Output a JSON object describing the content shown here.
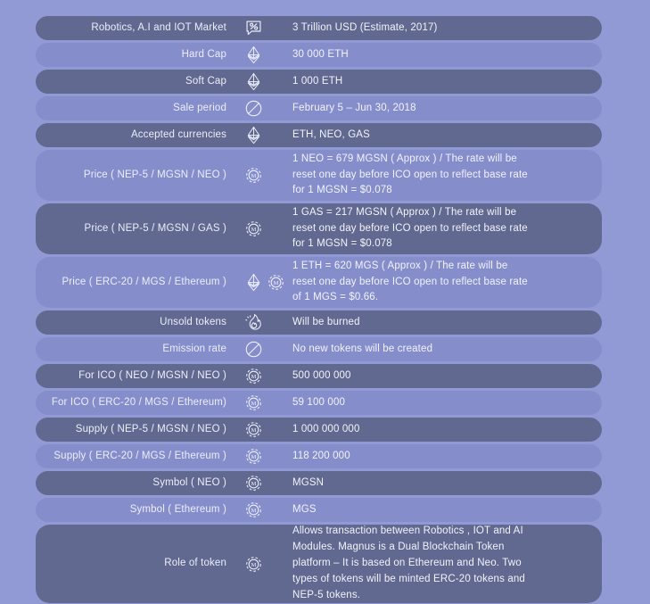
{
  "theme": {
    "background": "#919ad4",
    "row_dark": "#616990",
    "row_light": "#858ecb",
    "text": "#eceefb"
  },
  "table": {
    "name": "token-sale-details",
    "rows": [
      {
        "label": "Robotics, A.I and IOT Market",
        "icons": [
          "percent-bubble-icon"
        ],
        "value_lines": [
          "3 Trillion USD (Estimate, 2017)"
        ],
        "shade": "dark"
      },
      {
        "label": "Hard Cap",
        "icons": [
          "ethereum-icon"
        ],
        "value_lines": [
          "30 000 ETH"
        ],
        "shade": "light"
      },
      {
        "label": "Soft Cap",
        "icons": [
          "ethereum-icon"
        ],
        "value_lines": [
          "1 000 ETH"
        ],
        "shade": "dark"
      },
      {
        "label": "Sale period",
        "icons": [
          "circle-slash-icon"
        ],
        "value_lines": [
          "February 5 – Jun 30, 2018"
        ],
        "shade": "light"
      },
      {
        "label": "Accepted currencies",
        "icons": [
          "ethereum-icon"
        ],
        "value_lines": [
          "ETH, NEO, GAS"
        ],
        "shade": "dark"
      },
      {
        "label": "Price ( NEP-5 / MGSN / NEO )",
        "icons": [
          "magnus-token-icon"
        ],
        "value_lines": [
          "1 NEO = 679 MGSN ( Approx ) / The rate will be",
          "reset one day before ICO open to reflect base rate",
          "for 1 MGSN = $0.078"
        ],
        "shade": "light"
      },
      {
        "label": "Price ( NEP-5 / MGSN / GAS )",
        "icons": [
          "magnus-token-icon"
        ],
        "value_lines": [
          "1 GAS = 217 MGSN ( Approx ) / The rate will be",
          "reset one day before ICO open to reflect base rate",
          "for 1 MGSN = $0.078"
        ],
        "shade": "dark"
      },
      {
        "label": "Price ( ERC-20 / MGS / Ethereum )",
        "icons": [
          "ethereum-icon",
          "magnus-token-icon"
        ],
        "value_lines": [
          "1 ETH = 620 MGS ( Approx ) / The rate will be",
          "reset one day before ICO open to reflect base rate",
          "of 1 MGS = $0.66."
        ],
        "shade": "light"
      },
      {
        "label": "Unsold tokens",
        "icons": [
          "flame-icon"
        ],
        "value_lines": [
          "Will be burned"
        ],
        "shade": "dark"
      },
      {
        "label": "Emission rate",
        "icons": [
          "circle-slash-icon"
        ],
        "value_lines": [
          "No new tokens will be created"
        ],
        "shade": "light"
      },
      {
        "label": "For ICO ( NEO / MGSN / NEO )",
        "icons": [
          "magnus-token-icon"
        ],
        "value_lines": [
          "500 000 000"
        ],
        "shade": "dark"
      },
      {
        "label": "For ICO ( ERC-20 / MGS / Ethereum)",
        "icons": [
          "magnus-token-icon"
        ],
        "value_lines": [
          "59 100 000"
        ],
        "shade": "light"
      },
      {
        "label": "Supply ( NEP-5 / MGSN / NEO )",
        "icons": [
          "magnus-token-icon"
        ],
        "value_lines": [
          "1 000 000 000"
        ],
        "shade": "dark"
      },
      {
        "label": "Supply ( ERC-20 / MGS / Ethereum )",
        "icons": [
          "magnus-token-icon"
        ],
        "value_lines": [
          "118 200 000"
        ],
        "shade": "light"
      },
      {
        "label": "Symbol ( NEO )",
        "icons": [
          "magnus-token-icon"
        ],
        "value_lines": [
          "MGSN"
        ],
        "shade": "dark"
      },
      {
        "label": "Symbol ( Ethereum )",
        "icons": [
          "magnus-token-icon"
        ],
        "value_lines": [
          "MGS"
        ],
        "shade": "light"
      },
      {
        "label": "Role of token",
        "icons": [
          "magnus-token-icon"
        ],
        "value_lines": [
          "Allows transaction between Robotics , IOT and AI",
          "Modules. Magnus is a Dual Blockchain Token",
          "platform – It is based on Ethereum and Neo. Two",
          "types of tokens will be minted ERC-20 tokens and",
          "NEP-5 tokens."
        ],
        "shade": "dark"
      }
    ]
  }
}
